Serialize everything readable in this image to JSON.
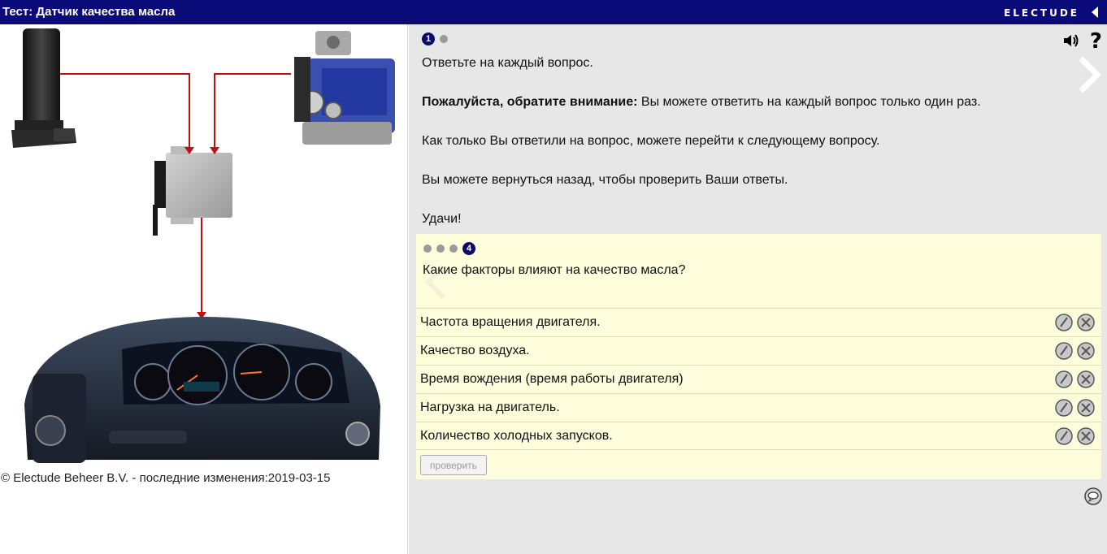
{
  "topbar": {
    "title": "Тест: Датчик качества масла",
    "brand": "ELECTUDE"
  },
  "footer": {
    "copyright": "© Electude Beheer B.V. - последние изменения:2019-03-15"
  },
  "intro": {
    "active_page": "1",
    "line1": "Ответьте на каждый вопрос.",
    "note_bold": "Пожалуйста, обратите внимание:",
    "note_rest": " Вы можете ответить на каждый вопрос только один раз.",
    "line3": "Как только Вы ответили на вопрос, можете перейти к следующему вопросу.",
    "line4": "Вы можете вернуться назад, чтобы проверить Ваши ответы.",
    "line5": "Удачи!"
  },
  "toolbar": {
    "help": "?"
  },
  "quiz": {
    "active_page": "4",
    "question": "Какие факторы влияют на качество масла?",
    "answers": [
      "Частота вращения двигателя.",
      "Качество воздуха.",
      "Время вождения (время работы двигателя)",
      "Нагрузка на двигатель.",
      "Количество холодных запусков."
    ],
    "check_label": "проверить"
  },
  "icons": {
    "sound": "speaker-icon",
    "help": "question-mark-icon",
    "next": "chevron-right-icon",
    "prev": "chevron-left-icon",
    "collapse": "triangle-left-icon",
    "correct": "check-circle-icon",
    "wrong": "cross-circle-icon",
    "chat": "speech-bubble-icon"
  },
  "colors": {
    "topbar": "#0a0a78",
    "panel": "#e7e7e7",
    "question_panel": "#fdfddb",
    "wire": "#c01010"
  }
}
